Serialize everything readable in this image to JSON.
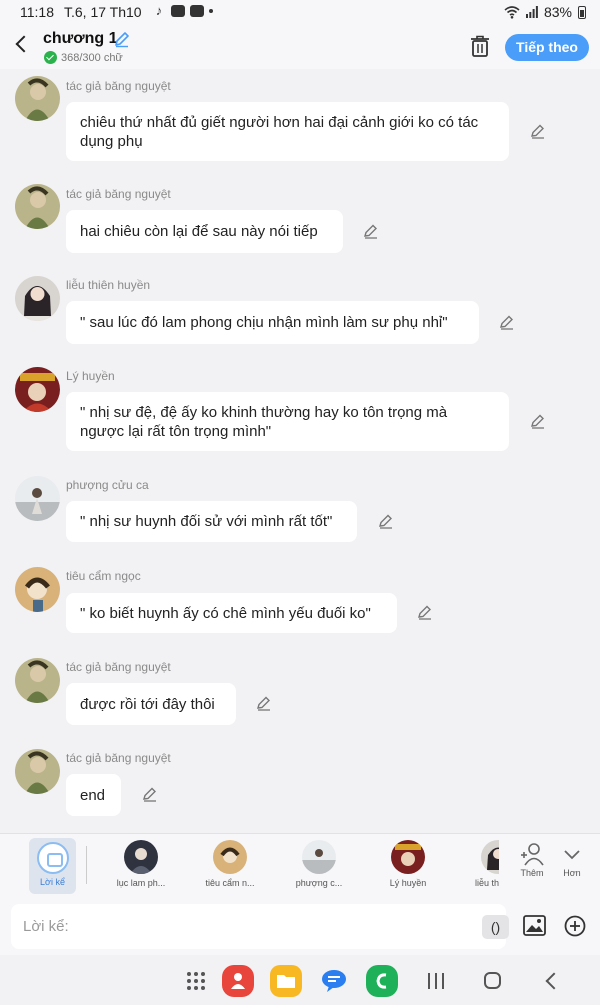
{
  "status_bar": {
    "time": "11:18",
    "date": "T.6, 17 Th10",
    "battery": "83%"
  },
  "header": {
    "title": "chương 1",
    "word_count": "368/300 chữ",
    "next_button": "Tiếp theo"
  },
  "messages": [
    {
      "sender": "tác giả băng nguyệt",
      "text": "chiêu thứ nhất đủ giết người hơn hai đại cảnh giới ko có tác dụng phụ",
      "avatar_color": "#8a9a5a"
    },
    {
      "sender": "tác giả băng nguyệt",
      "text": "hai chiêu còn lại để sau này nói tiếp",
      "avatar_color": "#8a9a5a"
    },
    {
      "sender": "liễu thiên huyền",
      "text": "\" sau lúc đó lam phong chịu nhận mình làm sư phụ nhỉ\"",
      "avatar_color": "#3a3a44"
    },
    {
      "sender": "Lý huyền",
      "text": "\" nhị sư đệ, đệ ấy ko khinh thường hay ko tôn trọng mà ngược lại rất tôn trọng mình\"",
      "avatar_color": "#b52b2b"
    },
    {
      "sender": "phượng cửu ca",
      "text": "\" nhị sư huynh đối sử với mình rất tốt\"",
      "avatar_color": "#9aa3a8"
    },
    {
      "sender": "tiêu cẩm ngọc",
      "text": "\" ko biết huynh ấy có chê mình yếu đuối ko\"",
      "avatar_color": "#c69a5a"
    },
    {
      "sender": "tác giả băng nguyệt",
      "text": "được rồi tới đây thôi",
      "avatar_color": "#8a9a5a"
    },
    {
      "sender": "tác giả băng nguyệt",
      "text": "end",
      "avatar_color": "#8a9a5a"
    }
  ],
  "mention_bar": {
    "loike_label": "Lời kể",
    "characters": [
      {
        "label": "lục lam ph...",
        "avatar_color": "#2f3340"
      },
      {
        "label": "tiêu cẩm n...",
        "avatar_color": "#c69a5a"
      },
      {
        "label": "phượng c...",
        "avatar_color": "#9aa3a8"
      },
      {
        "label": "Lý huyền",
        "avatar_color": "#b52b2b"
      },
      {
        "label": "liễu th",
        "avatar_color": "#3a3a44"
      }
    ],
    "add_label": "Thêm",
    "more_label": "Hơn"
  },
  "input": {
    "placeholder": "Lời kể:",
    "paren_label": "()"
  },
  "nav_apps": [
    {
      "name": "app-red",
      "color": "#e8453c"
    },
    {
      "name": "app-folder",
      "color": "#f7b824"
    },
    {
      "name": "app-messages",
      "color": "#2a7ef0"
    },
    {
      "name": "app-phone",
      "color": "#1fb05a"
    }
  ]
}
